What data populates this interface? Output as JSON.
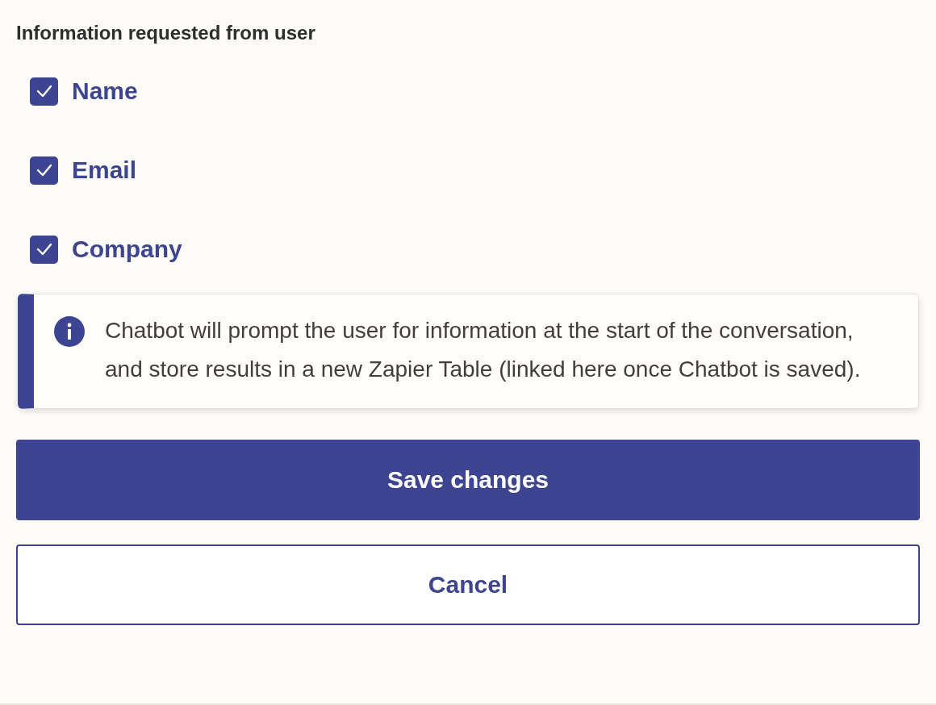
{
  "section_title": "Information requested from user",
  "fields": [
    {
      "label": "Name",
      "checked": true
    },
    {
      "label": "Email",
      "checked": true
    },
    {
      "label": "Company",
      "checked": true
    }
  ],
  "info": {
    "text": "Chatbot will prompt the user for information at the start of the conversation, and store results in a new Zapier Table (linked here once Chatbot is saved)."
  },
  "buttons": [
    {
      "label": "Save changes",
      "kind": "primary"
    },
    {
      "label": "Cancel",
      "kind": "secondary"
    }
  ]
}
